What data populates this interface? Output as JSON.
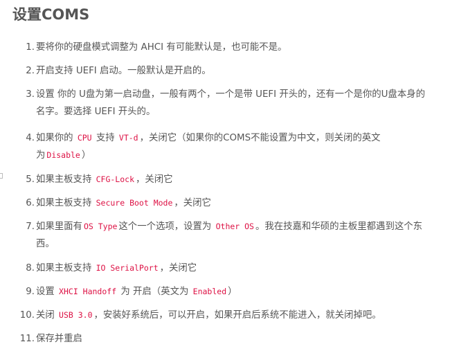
{
  "title": "设置COMS",
  "items": [
    {
      "num": "1.",
      "lines": [
        [
          {
            "t": "要将你的硬盘模式调整为 AHCI 有可能默认是，也可能不是。"
          }
        ]
      ]
    },
    {
      "num": "2.",
      "lines": [
        [
          {
            "t": "开启支持 UEFI 启动。一般默认是开启的。"
          }
        ]
      ]
    },
    {
      "num": "3.",
      "lines": [
        [
          {
            "t": "设置 你的 U盘为第一启动盘，一般有两个，一个是带 UEFI 开头的，还有一个是你的U盘本身的"
          }
        ],
        [
          {
            "t": "名字。要选择 UEFI 开头的。"
          }
        ]
      ]
    },
    {
      "num": "4.",
      "lines": [
        [
          {
            "t": "如果你的 "
          },
          {
            "c": "CPU"
          },
          {
            "t": " 支持 "
          },
          {
            "c": "VT-d"
          },
          {
            "t": "，关闭它（如果你的COMS不能设置为中文，则关闭的英文"
          }
        ],
        [
          {
            "t": "为"
          },
          {
            "c": "Disable"
          },
          {
            "t": "）"
          }
        ]
      ]
    },
    {
      "num": "5.",
      "lines": [
        [
          {
            "t": "如果主板支持 "
          },
          {
            "c": "CFG-Lock"
          },
          {
            "t": "，关闭它"
          }
        ]
      ]
    },
    {
      "num": "6.",
      "lines": [
        [
          {
            "t": "如果主板支持 "
          },
          {
            "c": "Secure Boot Mode"
          },
          {
            "t": "，关闭它"
          }
        ]
      ]
    },
    {
      "num": "7.",
      "lines": [
        [
          {
            "t": "如果里面有"
          },
          {
            "c": "OS Type"
          },
          {
            "t": "这个一个选项，设置为 "
          },
          {
            "c": "Other OS"
          },
          {
            "t": "。我在技嘉和华硕的主板里都遇到这个东"
          }
        ],
        [
          {
            "t": "西。"
          }
        ]
      ]
    },
    {
      "num": "8.",
      "lines": [
        [
          {
            "t": "如果主板支持 "
          },
          {
            "c": "IO SerialPort"
          },
          {
            "t": "，关闭它"
          }
        ]
      ]
    },
    {
      "num": "9.",
      "lines": [
        [
          {
            "t": "设置 "
          },
          {
            "c": "XHCI Handoff"
          },
          {
            "t": " 为 开启（英文为 "
          },
          {
            "c": "Enabled"
          },
          {
            "t": "）"
          }
        ]
      ]
    },
    {
      "num": "10.",
      "lines": [
        [
          {
            "t": "关闭 "
          },
          {
            "c": "USB 3.0"
          },
          {
            "t": "，安装好系统后，可以开启，如果开启后系统不能进入，就关闭掉吧。"
          }
        ]
      ]
    },
    {
      "num": "11.",
      "lines": [
        [
          {
            "t": "保存并重启"
          }
        ]
      ]
    }
  ]
}
